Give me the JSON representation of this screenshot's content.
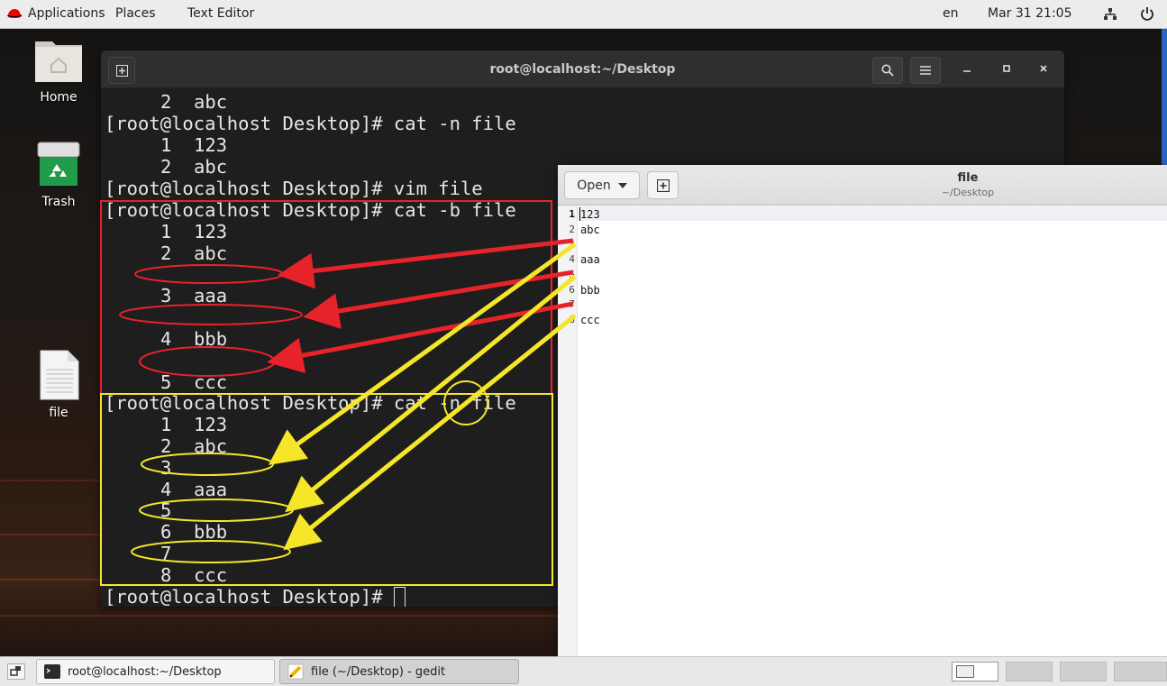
{
  "topbar": {
    "applications": "Applications",
    "places": "Places",
    "text_editor": "Text Editor",
    "language": "en",
    "datetime": "Mar 31  21:05",
    "network_icon": "network-icon",
    "power_icon": "power-icon"
  },
  "desktop": {
    "icons": [
      {
        "label": "Home",
        "icon": "home-folder-icon"
      },
      {
        "label": "Trash",
        "icon": "trash-icon"
      },
      {
        "label": "file",
        "icon": "text-file-icon"
      }
    ]
  },
  "terminal": {
    "title": "root@localhost:~/Desktop",
    "lines": [
      {
        "text": "2  abc",
        "indent": true
      },
      {
        "text": "[root@localhost Desktop]# cat -n file",
        "indent": false
      },
      {
        "text": "1  123",
        "indent": true
      },
      {
        "text": "2  abc",
        "indent": true
      },
      {
        "text": "[root@localhost Desktop]# vim file",
        "indent": false
      },
      {
        "text": "[root@localhost Desktop]# cat -b file",
        "indent": false
      },
      {
        "text": "1  123",
        "indent": true
      },
      {
        "text": "2  abc",
        "indent": true
      },
      {
        "text": "",
        "indent": true
      },
      {
        "text": "3  aaa",
        "indent": true
      },
      {
        "text": "",
        "indent": true
      },
      {
        "text": "4  bbb",
        "indent": true
      },
      {
        "text": "",
        "indent": true
      },
      {
        "text": "5  ccc",
        "indent": true
      },
      {
        "text": "[root@localhost Desktop]# cat -n file",
        "indent": false
      },
      {
        "text": "1  123",
        "indent": true
      },
      {
        "text": "2  abc",
        "indent": true
      },
      {
        "text": "3",
        "indent": true
      },
      {
        "text": "4  aaa",
        "indent": true
      },
      {
        "text": "5",
        "indent": true
      },
      {
        "text": "6  bbb",
        "indent": true
      },
      {
        "text": "7",
        "indent": true
      },
      {
        "text": "8  ccc",
        "indent": true
      }
    ],
    "prompt": "[root@localhost Desktop]# "
  },
  "gedit": {
    "open_label": "Open",
    "doc_title": "file",
    "doc_path": "~/Desktop",
    "lines": [
      {
        "num": "1",
        "text": "123"
      },
      {
        "num": "2",
        "text": "abc"
      },
      {
        "num": "3",
        "text": ""
      },
      {
        "num": "4",
        "text": "aaa"
      },
      {
        "num": "5",
        "text": ""
      },
      {
        "num": "6",
        "text": "bbb"
      },
      {
        "num": "7",
        "text": ""
      },
      {
        "num": "8",
        "text": "ccc"
      }
    ]
  },
  "taskbar": {
    "tasks": [
      {
        "label": "root@localhost:~/Desktop",
        "icon": "terminal-icon",
        "active": false
      },
      {
        "label": "file (~/Desktop) - gedit",
        "icon": "text-editor-icon",
        "active": true
      }
    ]
  },
  "colors": {
    "annotation_red": "#e8222a",
    "annotation_yellow": "#f5e62a"
  }
}
